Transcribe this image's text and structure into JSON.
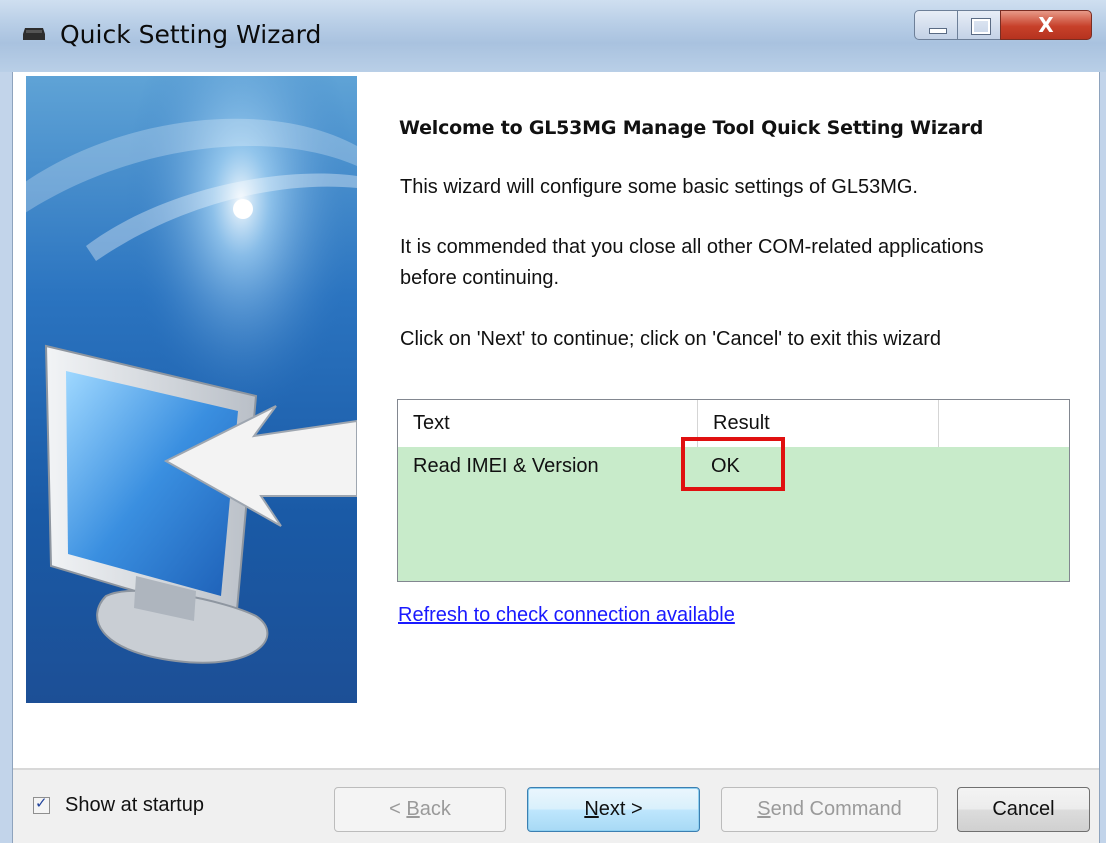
{
  "window": {
    "title": "Quick Setting Wizard",
    "controls": {
      "minimize": "",
      "maximize": "",
      "close": "X"
    }
  },
  "content": {
    "heading": "Welcome to GL53MG Manage Tool  Quick Setting Wizard",
    "paragraph1": "This wizard will configure some basic settings of GL53MG.",
    "paragraph2": "It is commended that you close all other COM-related applications before continuing.",
    "paragraph3": "Click on 'Next' to continue; click on 'Cancel' to exit this wizard"
  },
  "results_table": {
    "columns": [
      "Text",
      "Result",
      ""
    ],
    "rows": [
      {
        "text": "Read IMEI & Version",
        "result": "OK"
      }
    ],
    "row_color": "#c8ebca",
    "highlight_color": "#e01010"
  },
  "link": {
    "label": "Refresh to check connection available"
  },
  "footer": {
    "show_at_startup": {
      "label": "Show at startup",
      "checked": true
    },
    "buttons": {
      "back": {
        "pre": "< ",
        "accel": "B",
        "post": "ack",
        "enabled": false
      },
      "next": {
        "pre": "",
        "accel": "N",
        "post": "ext >",
        "enabled": true
      },
      "send": {
        "pre": "",
        "accel": "S",
        "post": "end Command",
        "enabled": false
      },
      "cancel": {
        "label": "Cancel",
        "enabled": true
      }
    }
  }
}
